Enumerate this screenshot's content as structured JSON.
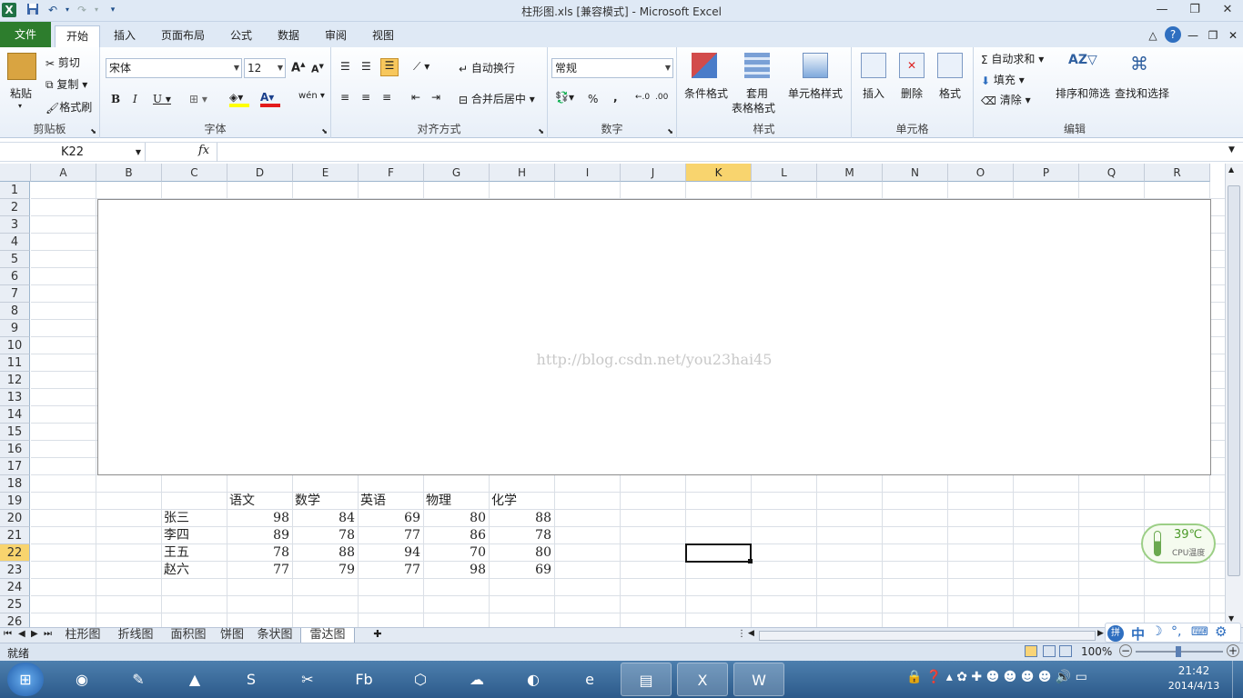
{
  "window": {
    "title": "柱形图.xls  [兼容模式]  -  Microsoft Excel",
    "min_icon": "minimize-icon",
    "restore_icon": "restore-icon",
    "close_icon": "close-icon"
  },
  "quick_access": [
    "excel-logo-icon",
    "save-icon",
    "undo-icon",
    "redo-icon",
    "customize-icon"
  ],
  "tabs": [
    "文件",
    "开始",
    "插入",
    "页面布局",
    "公式",
    "数据",
    "审阅",
    "视图"
  ],
  "active_tab": "开始",
  "ribbon": {
    "clipboard": {
      "label": "剪贴板",
      "paste": "粘贴",
      "cut": "剪切",
      "copy": "复制",
      "format_painter": "格式刷"
    },
    "font": {
      "label": "字体",
      "font_name": "宋体",
      "font_size": "12"
    },
    "alignment": {
      "label": "对齐方式",
      "wrap": "自动换行",
      "merge": "合并后居中"
    },
    "number": {
      "label": "数字",
      "format": "常规",
      "percent": "%",
      "comma": ","
    },
    "styles": {
      "label": "样式",
      "conditional": "条件格式",
      "table_format_1": "套用",
      "table_format_2": "表格格式",
      "cell_styles": "单元格样式"
    },
    "cells": {
      "label": "单元格",
      "insert": "插入",
      "delete": "删除",
      "format": "格式"
    },
    "editing": {
      "label": "编辑",
      "autosum": "自动求和",
      "fill": "填充",
      "clear": "清除",
      "sort": "排序和筛选",
      "find": "查找和选择"
    }
  },
  "formula_bar": {
    "name_box": "K22",
    "fx": "fx",
    "value": ""
  },
  "columns": [
    "A",
    "B",
    "C",
    "D",
    "E",
    "F",
    "G",
    "H",
    "I",
    "J",
    "K",
    "L",
    "M",
    "N",
    "O",
    "P",
    "Q",
    "R"
  ],
  "selected_column": "K",
  "rows": [
    "1",
    "2",
    "3",
    "4",
    "5",
    "6",
    "7",
    "8",
    "9",
    "10",
    "11",
    "12",
    "13",
    "14",
    "15",
    "16",
    "17",
    "18",
    "19",
    "20",
    "21",
    "22",
    "23",
    "24",
    "25",
    "26"
  ],
  "selected_row": "22",
  "chart": {
    "watermark": "http://blog.csdn.net/you23hai45"
  },
  "table": {
    "headers": [
      "语文",
      "数学",
      "英语",
      "物理",
      "化学"
    ],
    "rows": [
      {
        "name": "张三",
        "values": [
          "98",
          "84",
          "69",
          "80",
          "88"
        ]
      },
      {
        "name": "李四",
        "values": [
          "89",
          "78",
          "77",
          "86",
          "78"
        ]
      },
      {
        "name": "王五",
        "values": [
          "78",
          "88",
          "94",
          "70",
          "80"
        ]
      },
      {
        "name": "赵六",
        "values": [
          "77",
          "79",
          "77",
          "98",
          "69"
        ]
      }
    ]
  },
  "sheets": [
    "柱形图",
    "折线图",
    "面积图",
    "饼图",
    "条状图",
    "雷达图"
  ],
  "active_sheet": "雷达图",
  "status": {
    "ready": "就绪",
    "zoom": "100%"
  },
  "cpu_widget": {
    "temp": "39℃",
    "label": "CPU温度"
  },
  "taskbar": {
    "apps": [
      "start-orb-icon",
      "eclipse-icon",
      "notepad-plus-icon",
      "matlab-icon",
      "sublime-icon",
      "xmind-icon",
      "flash-builder-icon",
      "virtualbox-icon",
      "cloud-icon",
      "firefox-icon",
      "ie-icon",
      "explorer-icon",
      "excel-icon",
      "word-icon"
    ],
    "active": [
      "explorer-icon",
      "excel-icon",
      "word-icon"
    ],
    "time": "21:42",
    "date": "2014/4/13"
  },
  "ime": {
    "lang": "中"
  }
}
